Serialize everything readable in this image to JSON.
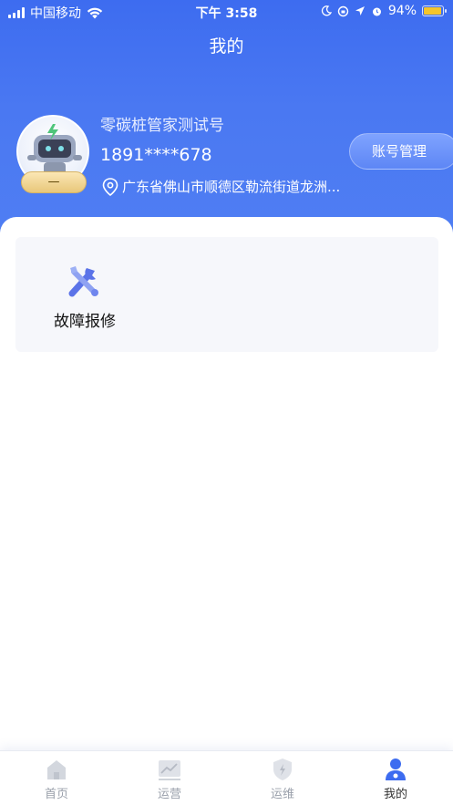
{
  "status_bar": {
    "carrier": "中国移动",
    "time": "下午 3:58",
    "battery": "94%",
    "battery_level": 0.94
  },
  "nav": {
    "title": "我的"
  },
  "profile": {
    "name": "零碳桩管家测试号",
    "phone": "1891****678",
    "address": "广东省佛山市顺德区勒流街道龙洲...",
    "badge": "—",
    "account_button": "账号管理"
  },
  "services": [
    {
      "label": "故障报修",
      "icon": "wrench-screwdriver-icon"
    }
  ],
  "tabbar": {
    "items": [
      {
        "label": "首页",
        "icon": "home-icon",
        "active": false
      },
      {
        "label": "运营",
        "icon": "chart-icon",
        "active": false
      },
      {
        "label": "运维",
        "icon": "shield-bolt-icon",
        "active": false
      },
      {
        "label": "我的",
        "icon": "user-icon",
        "active": true
      }
    ]
  },
  "colors": {
    "header_blue": "#4a78f2",
    "badge_gold": "#e8c77a",
    "battery_yellow": "#f5c52b"
  }
}
